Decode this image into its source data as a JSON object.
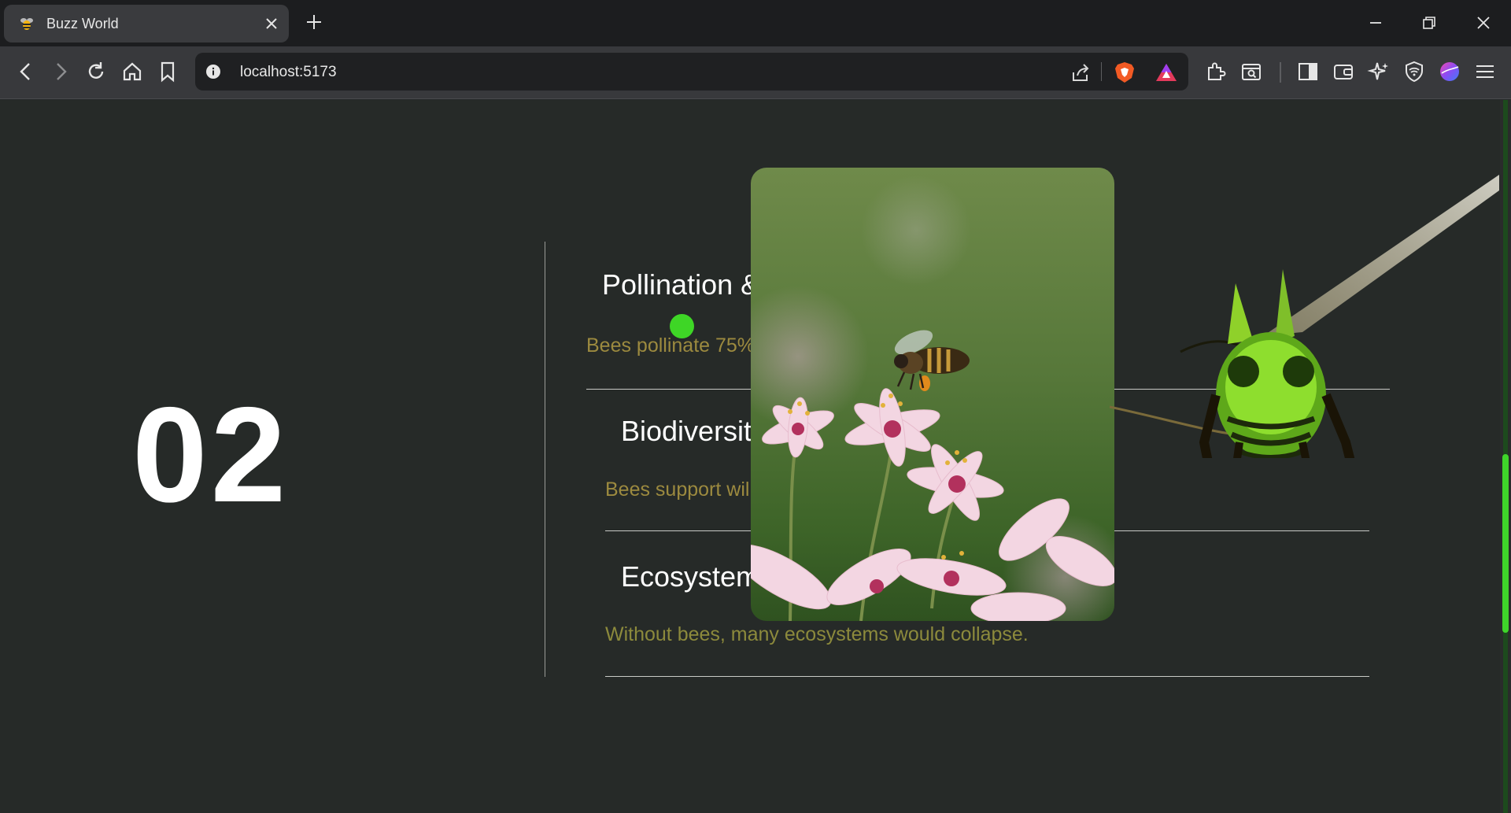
{
  "browser": {
    "tab": {
      "title": "Buzz World",
      "favicon": "bee-icon"
    },
    "url": "localhost:5173",
    "icons": [
      "back-icon",
      "forward-icon",
      "reload-icon",
      "home-icon",
      "bookmark-icon",
      "site-info-icon",
      "share-icon",
      "brave-shields-icon",
      "brave-rewards-icon",
      "extensions-icon",
      "screenshot-icon",
      "sidebar-icon",
      "wallet-icon",
      "leo-ai-icon",
      "vpn-icon",
      "profile-icon",
      "menu-icon"
    ]
  },
  "section": {
    "number": "02",
    "items": [
      {
        "title": "Pollination &",
        "description": "Bees pollinate 75%"
      },
      {
        "title": "Biodiversity",
        "description": "Bees support wil"
      },
      {
        "title": "Ecosystem",
        "description": "Without bees, many ecosystems would collapse."
      }
    ]
  },
  "colors": {
    "background": "#262a28",
    "description_text": "#9c8a3f",
    "cursor_dot": "#3ed626",
    "scroll_thumb": "#3fd62a"
  },
  "scroll": {
    "position_fraction": 0.62
  }
}
